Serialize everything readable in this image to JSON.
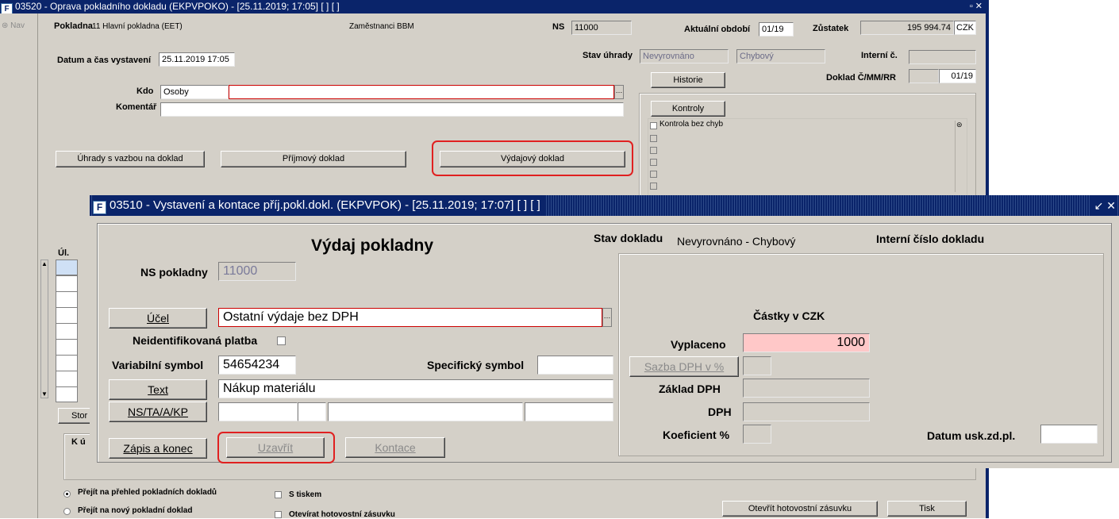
{
  "back": {
    "title": "03520 - Oprava pokladního dokladu (EKPVPOKO) - [25.11.2019; 17:05]  [ ]  [ ]",
    "nav_label": "Nav",
    "window_controls": "▫ ✕",
    "pokladna_label": "Pokladna",
    "pokladna_value": "11 Hlavní pokladna (EET)",
    "zamestnanci": "Zaměstnanci BBM",
    "ns_label": "NS",
    "ns_value": "11000",
    "aktualni_obdobi_label": "Aktuální období",
    "aktualni_obdobi_value": "01/19",
    "zustatek_label": "Zůstatek",
    "zustatek_value": "195 994.74",
    "currency": "CZK",
    "datum_label": "Datum a čas vystavení",
    "datum_value": "25.11.2019 17:05",
    "stav_uhrady_label": "Stav úhrady",
    "stav_uhrady_value1": "Nevyrovnáno",
    "stav_uhrady_value2": "Chybový",
    "interni_c_label": "Interní č.",
    "interni_c_value": "",
    "historie_button": "Historie",
    "doklad_label": "Doklad Č/MM/RR",
    "doklad_value": "01/19",
    "kdo_label": "Kdo",
    "kdo_type": "Osoby",
    "kdo_value": "",
    "komentar_label": "Komentář",
    "komentar_value": "",
    "kontroly_button": "Kontroly",
    "kontrola_item": "Kontrola bez chyb",
    "uhrady_button": "Úhrady s vazbou na doklad",
    "prijmovy_button": "Příjmový doklad",
    "vydajovy_button": "Výdajový doklad",
    "ul_label": "Úl.",
    "storno_button": "Stor",
    "k_group_label": "K ú",
    "radio1": "Přejít na přehled pokladních dokladů",
    "radio2": "Přejít na nový pokladní doklad",
    "check_tisk": "S tiskem",
    "check_zasuvka": "Otevírat hotovostní zásuvku",
    "otevrit_button": "Otevřít hotovostní zásuvku",
    "tisk_button": "Tisk"
  },
  "dialog": {
    "title": "03510 - Vystavení a kontace příj.pokl.dokl. (EKPVPOK) - [25.11.2019; 17:07]  [ ]  [ ]",
    "window_controls": "↙ ✕",
    "heading": "Výdaj pokladny",
    "stav_label": "Stav dokladu",
    "stav_value": "Nevyrovnáno - Chybový",
    "interni_label": "Interní číslo dokladu",
    "ns_label": "NS pokladny",
    "ns_value": "11000",
    "ucel_button": "Účel",
    "ucel_value": "Ostatní výdaje bez DPH",
    "neidentifikovana_label": "Neidentifikovaná platba",
    "variabilni_label": "Variabilní symbol",
    "variabilni_value": "54654234",
    "specificky_label": "Specifický symbol",
    "specificky_value": "",
    "text_button": "Text",
    "text_value": "Nákup materiálu",
    "ns_ta_button": "NS/TA/A/KP",
    "zapis_button": "Zápis a konec",
    "uzavrit_button": "Uzavřít",
    "kontace_button": "Kontace",
    "castky_label": "Částky v CZK",
    "vyplaceno_label": "Vyplaceno",
    "vyplaceno_value": "1000",
    "sazba_button": "Sazba DPH v %",
    "zaklad_label": "Základ DPH",
    "dph_label": "DPH",
    "koeficient_label": "Koeficient %",
    "datum_usk_label": "Datum usk.zd.pl.",
    "datum_usk_value": ""
  },
  "colors": {
    "titlebar": "#0a246a",
    "highlight": "#e02020",
    "pink_field": "#ffc8c8"
  }
}
